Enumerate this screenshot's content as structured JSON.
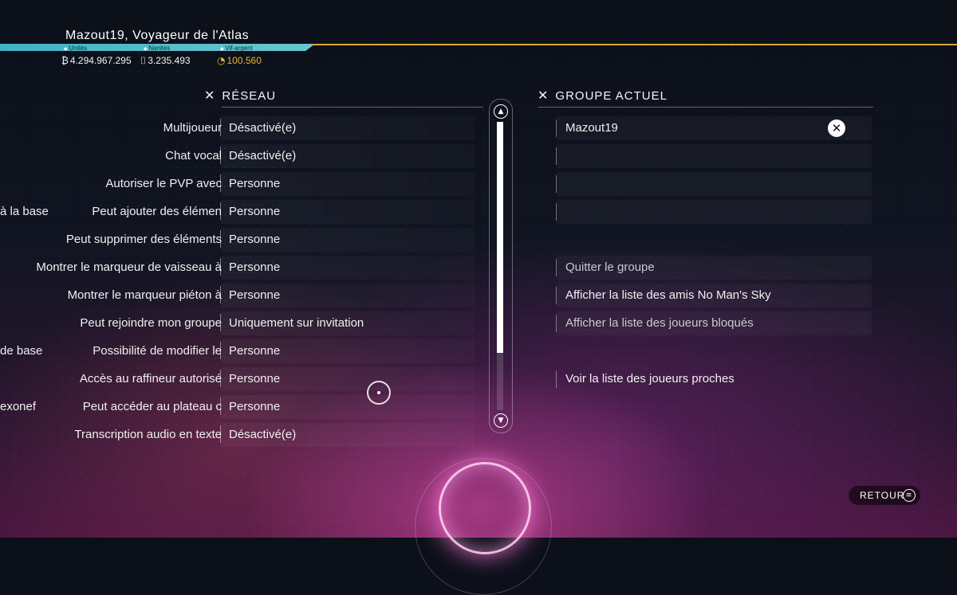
{
  "header": {
    "player_title": "Mazout19, Voyageur de l'Atlas",
    "currencies": [
      {
        "label": "Unités",
        "value": "4.294.967.295",
        "icon": "units-icon"
      },
      {
        "label": "Nanites",
        "value": "3.235.493",
        "icon": "nanites-icon"
      },
      {
        "label": "Vif-argent",
        "value": "100.560",
        "icon": "quicksilver-icon",
        "color": "#e9b53c"
      }
    ]
  },
  "network": {
    "title": "RÉSEAU",
    "rows": [
      {
        "prefix": "",
        "label": "Multijoueur",
        "value": "Désactivé(e)"
      },
      {
        "prefix": "",
        "label": "Chat vocal",
        "value": "Désactivé(e)"
      },
      {
        "prefix": "",
        "label": "Autoriser le PVP avec",
        "value": "Personne"
      },
      {
        "prefix": "à la base",
        "label": "Peut ajouter des élémen",
        "value": "Personne"
      },
      {
        "prefix": "",
        "label": "Peut supprimer des éléments",
        "value": "Personne"
      },
      {
        "prefix": "",
        "label": "Montrer le marqueur de vaisseau à",
        "value": "Personne"
      },
      {
        "prefix": "",
        "label": "Montrer le marqueur piéton à",
        "value": "Personne"
      },
      {
        "prefix": "",
        "label": "Peut rejoindre mon groupe",
        "value": "Uniquement sur invitation"
      },
      {
        "prefix": "de base",
        "label": "Possibilité de modifier le",
        "value": "Personne"
      },
      {
        "prefix": "",
        "label": "Accès au raffineur autorisé",
        "value": "Personne"
      },
      {
        "prefix": "exonef",
        "label": "Peut accéder au plateau c",
        "value": "Personne"
      },
      {
        "prefix": "",
        "label": "Transcription audio en texte",
        "value": "Désactivé(e)"
      }
    ]
  },
  "group": {
    "title": "GROUPE ACTUEL",
    "member": "Mazout19",
    "platform_icon": "xbox-icon",
    "actions": {
      "leave": "Quitter le groupe",
      "friends": "Afficher la liste des amis No Man's Sky",
      "blocked": "Afficher la liste des joueurs bloqués",
      "nearby": "Voir la liste des joueurs proches"
    }
  },
  "footer": {
    "back_label": "RETOUR"
  },
  "colors": {
    "accent_teal": "#3fb3c4",
    "accent_gold": "#d7a93a"
  }
}
